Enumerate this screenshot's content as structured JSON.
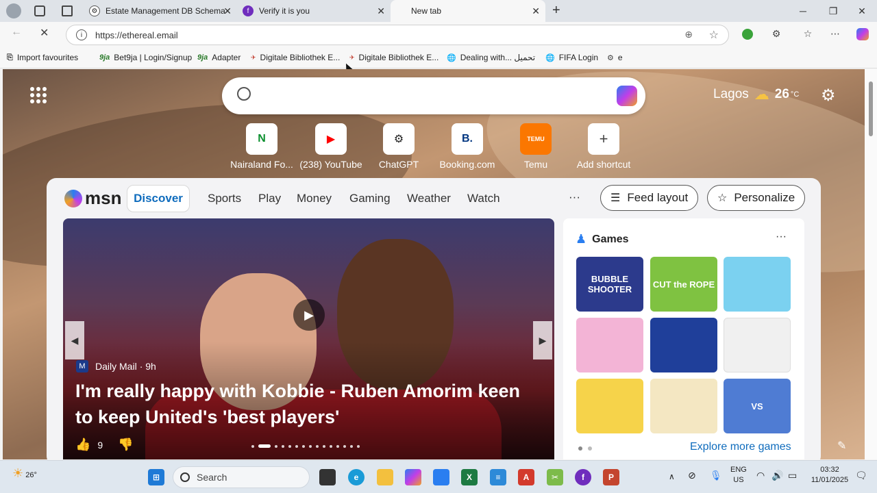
{
  "tabs": [
    {
      "title": "Estate Management DB Schema",
      "icon": "openai-icon"
    },
    {
      "title": "Verify it is you",
      "icon": "purple-f-icon"
    },
    {
      "title": "New tab",
      "icon": "msn-icon"
    }
  ],
  "address": {
    "url": "https://ethereal.email"
  },
  "bookmarks": [
    {
      "label": "Import favourites",
      "icon": "import-icon"
    },
    {
      "label": "Bet9ja | Login/Signup",
      "icon": "9ja"
    },
    {
      "label": "Adapter",
      "icon": "9ja"
    },
    {
      "label": "Digitale Bibliothek E...",
      "icon": "red-logo"
    },
    {
      "label": "Digitale Bibliothek E...",
      "icon": "red-logo"
    },
    {
      "label": "Dealing with... تحميل",
      "icon": "globe-icon"
    },
    {
      "label": "FIFA Login",
      "icon": "globe-icon"
    },
    {
      "label": "e",
      "icon": "openai-icon"
    }
  ],
  "weather": {
    "city": "Lagos",
    "temp": "26",
    "unit": "°C"
  },
  "shortcuts": [
    {
      "label": "Nairaland Fo...",
      "icon_text": "N",
      "color": "#0a8f2e"
    },
    {
      "label": "(238) YouTube",
      "icon_text": "▶",
      "color": "#ff0000"
    },
    {
      "label": "ChatGPT",
      "icon_text": "⚙",
      "color": "#222222"
    },
    {
      "label": "Booking.com",
      "icon_text": "B.",
      "color": "#003580"
    },
    {
      "label": "Temu",
      "icon_text": "TEMU",
      "color": "#fb7701"
    },
    {
      "label": "Add shortcut",
      "icon_text": "+",
      "color": "#444444"
    }
  ],
  "feed": {
    "logo": "msn",
    "tabs": [
      "Discover",
      "Sports",
      "Play",
      "Money",
      "Gaming",
      "Weather",
      "Watch"
    ],
    "more": "···",
    "feed_layout": "Feed layout",
    "personalize": "Personalize"
  },
  "hero": {
    "source": "Daily Mail",
    "age": "· 9h",
    "headline": "I'm really happy with Kobbie - Ruben Amorim keen to keep United's 'best players'",
    "likes": "9"
  },
  "games": {
    "title": "Games",
    "more": "···",
    "tiles": [
      {
        "label": "BUBBLE SHOOTER",
        "color": "#2c3a8c"
      },
      {
        "label": "CUT the ROPE",
        "color": "#7fc241"
      },
      {
        "label": "",
        "color": "#7bd1f0"
      },
      {
        "label": "",
        "color": "#f3b4d6"
      },
      {
        "label": "",
        "color": "#1f3f9a"
      },
      {
        "label": "",
        "color": "#f0f0f0"
      },
      {
        "label": "",
        "color": "#f6d34a"
      },
      {
        "label": "",
        "color": "#f4e7c2"
      },
      {
        "label": "VS",
        "color": "#4f7cd3"
      }
    ],
    "explore": "Explore more games"
  },
  "taskbar": {
    "weather_temp": "26°",
    "search": "Search",
    "lang1": "ENG",
    "lang2": "US",
    "time": "03:32",
    "date": "11/01/2025"
  }
}
